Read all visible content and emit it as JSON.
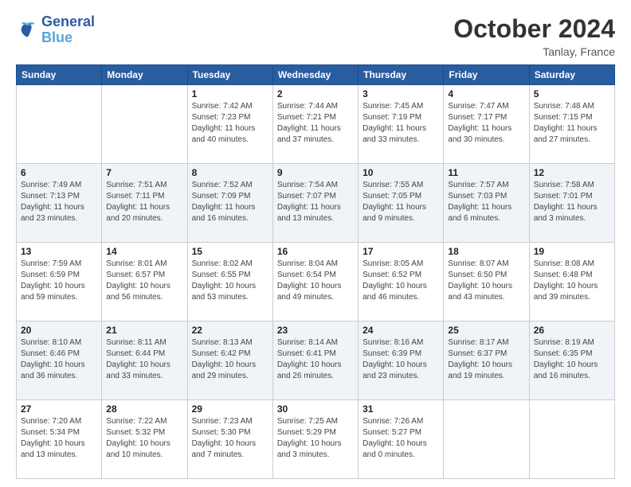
{
  "header": {
    "logo_line1": "General",
    "logo_line2": "Blue",
    "month": "October 2024",
    "location": "Tanlay, France"
  },
  "weekdays": [
    "Sunday",
    "Monday",
    "Tuesday",
    "Wednesday",
    "Thursday",
    "Friday",
    "Saturday"
  ],
  "weeks": [
    [
      {
        "day": "",
        "sunrise": "",
        "sunset": "",
        "daylight": ""
      },
      {
        "day": "",
        "sunrise": "",
        "sunset": "",
        "daylight": ""
      },
      {
        "day": "1",
        "sunrise": "Sunrise: 7:42 AM",
        "sunset": "Sunset: 7:23 PM",
        "daylight": "Daylight: 11 hours and 40 minutes."
      },
      {
        "day": "2",
        "sunrise": "Sunrise: 7:44 AM",
        "sunset": "Sunset: 7:21 PM",
        "daylight": "Daylight: 11 hours and 37 minutes."
      },
      {
        "day": "3",
        "sunrise": "Sunrise: 7:45 AM",
        "sunset": "Sunset: 7:19 PM",
        "daylight": "Daylight: 11 hours and 33 minutes."
      },
      {
        "day": "4",
        "sunrise": "Sunrise: 7:47 AM",
        "sunset": "Sunset: 7:17 PM",
        "daylight": "Daylight: 11 hours and 30 minutes."
      },
      {
        "day": "5",
        "sunrise": "Sunrise: 7:48 AM",
        "sunset": "Sunset: 7:15 PM",
        "daylight": "Daylight: 11 hours and 27 minutes."
      }
    ],
    [
      {
        "day": "6",
        "sunrise": "Sunrise: 7:49 AM",
        "sunset": "Sunset: 7:13 PM",
        "daylight": "Daylight: 11 hours and 23 minutes."
      },
      {
        "day": "7",
        "sunrise": "Sunrise: 7:51 AM",
        "sunset": "Sunset: 7:11 PM",
        "daylight": "Daylight: 11 hours and 20 minutes."
      },
      {
        "day": "8",
        "sunrise": "Sunrise: 7:52 AM",
        "sunset": "Sunset: 7:09 PM",
        "daylight": "Daylight: 11 hours and 16 minutes."
      },
      {
        "day": "9",
        "sunrise": "Sunrise: 7:54 AM",
        "sunset": "Sunset: 7:07 PM",
        "daylight": "Daylight: 11 hours and 13 minutes."
      },
      {
        "day": "10",
        "sunrise": "Sunrise: 7:55 AM",
        "sunset": "Sunset: 7:05 PM",
        "daylight": "Daylight: 11 hours and 9 minutes."
      },
      {
        "day": "11",
        "sunrise": "Sunrise: 7:57 AM",
        "sunset": "Sunset: 7:03 PM",
        "daylight": "Daylight: 11 hours and 6 minutes."
      },
      {
        "day": "12",
        "sunrise": "Sunrise: 7:58 AM",
        "sunset": "Sunset: 7:01 PM",
        "daylight": "Daylight: 11 hours and 3 minutes."
      }
    ],
    [
      {
        "day": "13",
        "sunrise": "Sunrise: 7:59 AM",
        "sunset": "Sunset: 6:59 PM",
        "daylight": "Daylight: 10 hours and 59 minutes."
      },
      {
        "day": "14",
        "sunrise": "Sunrise: 8:01 AM",
        "sunset": "Sunset: 6:57 PM",
        "daylight": "Daylight: 10 hours and 56 minutes."
      },
      {
        "day": "15",
        "sunrise": "Sunrise: 8:02 AM",
        "sunset": "Sunset: 6:55 PM",
        "daylight": "Daylight: 10 hours and 53 minutes."
      },
      {
        "day": "16",
        "sunrise": "Sunrise: 8:04 AM",
        "sunset": "Sunset: 6:54 PM",
        "daylight": "Daylight: 10 hours and 49 minutes."
      },
      {
        "day": "17",
        "sunrise": "Sunrise: 8:05 AM",
        "sunset": "Sunset: 6:52 PM",
        "daylight": "Daylight: 10 hours and 46 minutes."
      },
      {
        "day": "18",
        "sunrise": "Sunrise: 8:07 AM",
        "sunset": "Sunset: 6:50 PM",
        "daylight": "Daylight: 10 hours and 43 minutes."
      },
      {
        "day": "19",
        "sunrise": "Sunrise: 8:08 AM",
        "sunset": "Sunset: 6:48 PM",
        "daylight": "Daylight: 10 hours and 39 minutes."
      }
    ],
    [
      {
        "day": "20",
        "sunrise": "Sunrise: 8:10 AM",
        "sunset": "Sunset: 6:46 PM",
        "daylight": "Daylight: 10 hours and 36 minutes."
      },
      {
        "day": "21",
        "sunrise": "Sunrise: 8:11 AM",
        "sunset": "Sunset: 6:44 PM",
        "daylight": "Daylight: 10 hours and 33 minutes."
      },
      {
        "day": "22",
        "sunrise": "Sunrise: 8:13 AM",
        "sunset": "Sunset: 6:42 PM",
        "daylight": "Daylight: 10 hours and 29 minutes."
      },
      {
        "day": "23",
        "sunrise": "Sunrise: 8:14 AM",
        "sunset": "Sunset: 6:41 PM",
        "daylight": "Daylight: 10 hours and 26 minutes."
      },
      {
        "day": "24",
        "sunrise": "Sunrise: 8:16 AM",
        "sunset": "Sunset: 6:39 PM",
        "daylight": "Daylight: 10 hours and 23 minutes."
      },
      {
        "day": "25",
        "sunrise": "Sunrise: 8:17 AM",
        "sunset": "Sunset: 6:37 PM",
        "daylight": "Daylight: 10 hours and 19 minutes."
      },
      {
        "day": "26",
        "sunrise": "Sunrise: 8:19 AM",
        "sunset": "Sunset: 6:35 PM",
        "daylight": "Daylight: 10 hours and 16 minutes."
      }
    ],
    [
      {
        "day": "27",
        "sunrise": "Sunrise: 7:20 AM",
        "sunset": "Sunset: 5:34 PM",
        "daylight": "Daylight: 10 hours and 13 minutes."
      },
      {
        "day": "28",
        "sunrise": "Sunrise: 7:22 AM",
        "sunset": "Sunset: 5:32 PM",
        "daylight": "Daylight: 10 hours and 10 minutes."
      },
      {
        "day": "29",
        "sunrise": "Sunrise: 7:23 AM",
        "sunset": "Sunset: 5:30 PM",
        "daylight": "Daylight: 10 hours and 7 minutes."
      },
      {
        "day": "30",
        "sunrise": "Sunrise: 7:25 AM",
        "sunset": "Sunset: 5:29 PM",
        "daylight": "Daylight: 10 hours and 3 minutes."
      },
      {
        "day": "31",
        "sunrise": "Sunrise: 7:26 AM",
        "sunset": "Sunset: 5:27 PM",
        "daylight": "Daylight: 10 hours and 0 minutes."
      },
      {
        "day": "",
        "sunrise": "",
        "sunset": "",
        "daylight": ""
      },
      {
        "day": "",
        "sunrise": "",
        "sunset": "",
        "daylight": ""
      }
    ]
  ]
}
